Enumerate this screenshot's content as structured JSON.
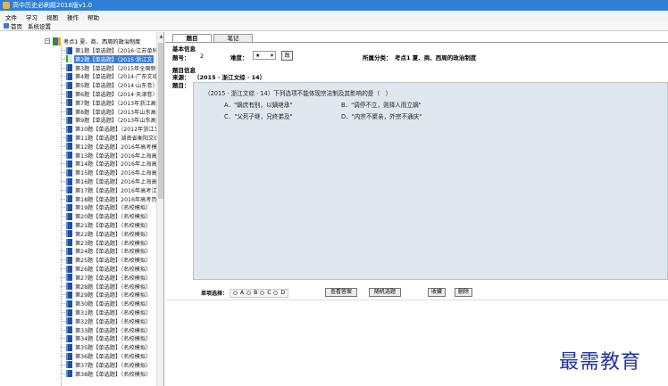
{
  "window": {
    "title": "高中历史必刷题2018版v1.0"
  },
  "menu": {
    "items": [
      "文件",
      "学习",
      "视图",
      "操作",
      "帮助"
    ]
  },
  "toolbar": {
    "home": "首页",
    "settings": "系统设置"
  },
  "tree": {
    "root": "考点1 夏、商、西周的政治制度",
    "items": [
      "第1题【单选题】（2016·江苏单科",
      "第2题【单选题】（2015·浙江文",
      "第3题【单选题】（2015年全国新课",
      "第4题【单选题】（2014·广东文综",
      "第5题【单选题】（2014·山东卷）",
      "第6题【单选题】（2014·天津卷）",
      "第7题【单选题】（2013年浙江高考",
      "第8题【单选题】（2013年山东高考",
      "第9题【单选题】（2013年山东高考",
      "第10题【单选题】（2012年浙江文",
      "第11题【单选题】湖南省衡阳文综",
      "第12题【单选题】2016年高考模拟",
      "第13题【单选题】2016年上海高考",
      "第14题【单选题】2016年上海高考",
      "第15题【单选题】2016年上海高考",
      "第16题【单选题】2016年上海高考",
      "第17题【单选题】2016年高考江苏",
      "第18题【单选题】2016年高考历史",
      "第19题【单选题】（名校模拟）",
      "第20题【单选题】（名校模拟）",
      "第21题【单选题】（名校模拟）",
      "第22题【单选题】（名校模拟）",
      "第23题【单选题】（名校模拟）",
      "第24题【单选题】（名校模拟）",
      "第25题【单选题】（名校模拟）",
      "第26题【单选题】（名校模拟）",
      "第27题【单选题】（名校模拟）",
      "第28题【单选题】（名校模拟）",
      "第29题【单选题】（名校模拟）",
      "第30题【单选题】（名校模拟）",
      "第31题【单选题】（名校模拟）",
      "第32题【单选题】（名校模拟）",
      "第33题【单选题】（名校模拟）",
      "第34题【单选题】（名校模拟）",
      "第35题【单选题】（名校模拟）",
      "第36题【单选题】（名校模拟）",
      "第37题【单选题】（名校模拟）",
      "第38题【单选题】（名校模拟）"
    ]
  },
  "tabs": {
    "question": "题目",
    "notes": "笔记"
  },
  "info": {
    "basic_title": "基本信息",
    "number_label": "题号：",
    "number_value": "2",
    "difficulty_label": "难度：",
    "difficulty_value": "★",
    "modify_button": "改",
    "category_label": "所属分类：",
    "category_value": "考点1 夏、商、西周的政治制度",
    "question_info_title": "题目信息",
    "source_label": "来源：",
    "source_value": "（2015 · 浙江文综 · 14）",
    "question_label": "题目："
  },
  "question": {
    "stem": "（2015 · 浙江文综 · 14）下列选项不能体现宗法制及其影响的是（　）",
    "option_a": "A．\"嫡庶有别，以嫡继承\"",
    "option_b": "B．\"调停不立，则择人而立嫡\"",
    "option_c": "C．\"父死子继，兄终弟及\"",
    "option_d": "D．\"内宗不聚亲，外宗不通庆\""
  },
  "bottom": {
    "choice_label": "单项选择：",
    "options": [
      "A",
      "B",
      "C",
      "D"
    ],
    "view_answer": "查看答案",
    "random": "随机选题",
    "favorite": "收藏",
    "delete": "删除"
  },
  "watermark": "最需教育"
}
